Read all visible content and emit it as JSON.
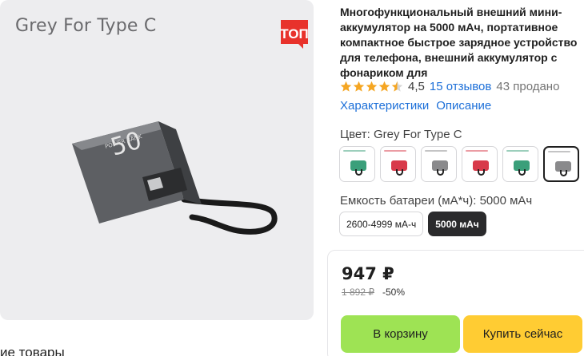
{
  "gallery": {
    "image_label": "Grey For Type C",
    "badge_text": "ТОП",
    "device_text_big": "50",
    "device_text_small": "POWER BANK"
  },
  "below_gallery_text": "ие товары",
  "product": {
    "title": "Многофункциональный внешний мини-аккумулятор на 5000 мАч, портативное компактное быстрое зарядное устройство для телефона, внешний аккумулятор с фонариком для",
    "rating": "4,5",
    "stars_filled": 4.5,
    "reviews": "15 отзывов",
    "sold": "43 продано"
  },
  "tabs": [
    "Характеристики",
    "Описание"
  ],
  "color": {
    "label": "Цвет: Grey For Type C",
    "options": [
      {
        "color": "#3a9f7a"
      },
      {
        "color": "#d83a4a"
      },
      {
        "color": "#8a8a8c"
      },
      {
        "color": "#d83a4a"
      },
      {
        "color": "#3a9f7a"
      },
      {
        "color": "#8a8a8c"
      }
    ],
    "selected_index": 5
  },
  "capacity": {
    "label": "Емкость батареи (мА*ч): 5000 мАч",
    "options": [
      "2600-4999 мА-ч",
      "5000 мАч"
    ],
    "selected_index": 1
  },
  "buy": {
    "price": "947 ₽",
    "old_price": "1 892 ₽",
    "discount": "-50%",
    "cart_label": "В корзину",
    "buy_now_label": "Купить сейчас"
  },
  "colors": {
    "accent_link": "#1c6fd8",
    "cart_button": "#9ee354",
    "buy_button": "#ffcc33",
    "star": "#f5a623",
    "badge": "#e8322b"
  }
}
